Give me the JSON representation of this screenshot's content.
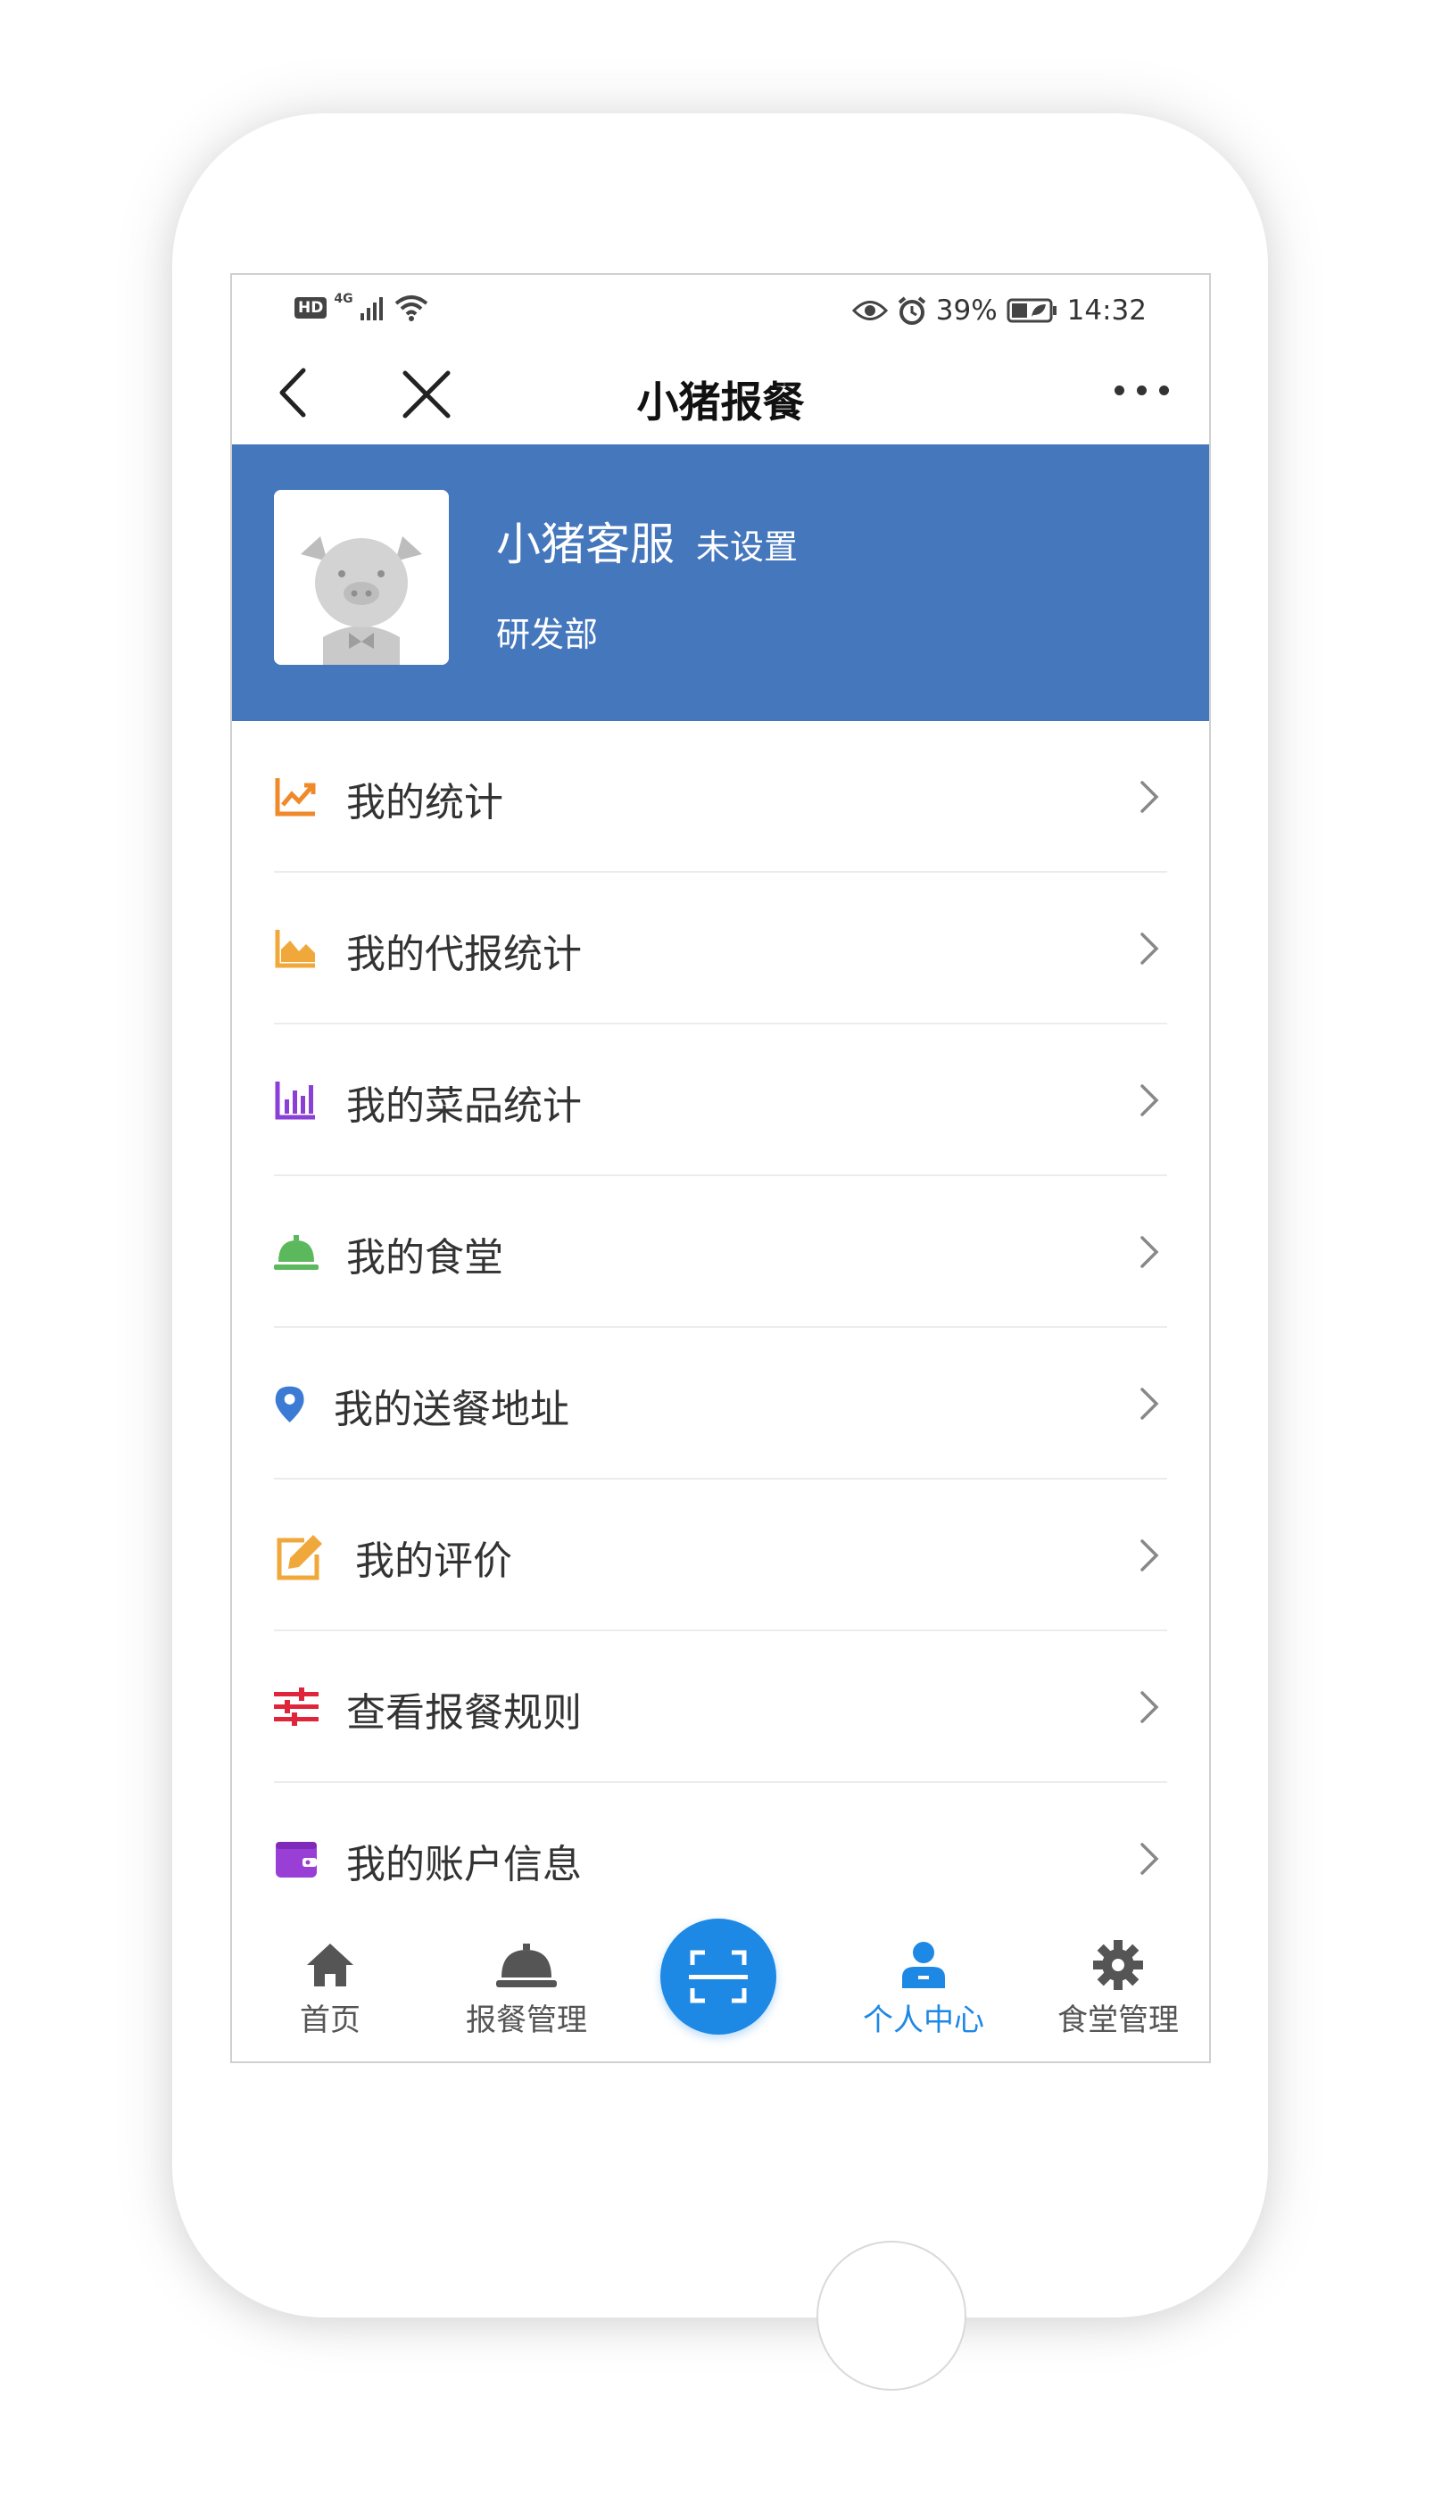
{
  "status_bar": {
    "network": "4G",
    "hd_badge": "HD",
    "battery_percent": "39%",
    "time": "14:32"
  },
  "nav": {
    "title": "小猪报餐"
  },
  "profile": {
    "name": "小猪客服",
    "status": "未设置",
    "department": "研发部"
  },
  "menu": {
    "items": [
      {
        "label": "我的统计",
        "icon": "line-chart-icon",
        "color": "#f0892a"
      },
      {
        "label": "我的代报统计",
        "icon": "area-chart-icon",
        "color": "#f0a83a"
      },
      {
        "label": "我的菜品统计",
        "icon": "bar-chart-icon",
        "color": "#8a3fd6"
      },
      {
        "label": "我的食堂",
        "icon": "service-bell-icon",
        "color": "#5cb85c"
      },
      {
        "label": "我的送餐地址",
        "icon": "location-pin-icon",
        "color": "#3b7bd4"
      },
      {
        "label": "我的评价",
        "icon": "edit-icon",
        "color": "#f0a83a"
      },
      {
        "label": "查看报餐规则",
        "icon": "sliders-icon",
        "color": "#e0243a"
      },
      {
        "label": "我的账户信息",
        "icon": "wallet-icon",
        "color": "#9a3fd6"
      }
    ]
  },
  "tabs": {
    "home": "首页",
    "meal_manage": "报餐管理",
    "scan": "scan-icon",
    "personal": "个人中心",
    "canteen_manage": "食堂管理"
  }
}
